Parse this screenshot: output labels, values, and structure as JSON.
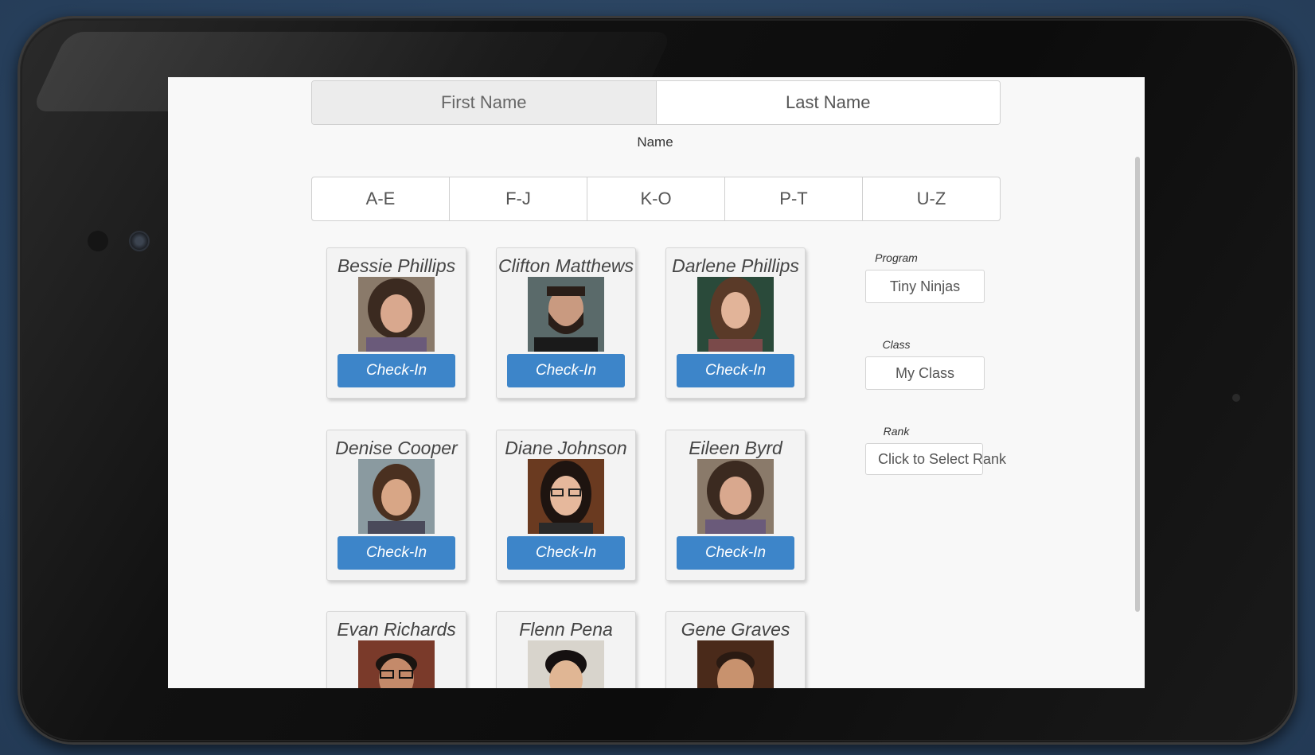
{
  "name_toggle": {
    "first": "First Name",
    "last": "Last Name"
  },
  "sort_label": "Name",
  "alpha_ranges": [
    "A-E",
    "F-J",
    "K-O",
    "P-T",
    "U-Z"
  ],
  "students": [
    {
      "name": "Bessie Phillips",
      "photo": "woman-curly-hair-photo",
      "action": "Check-In"
    },
    {
      "name": "Clifton Matthews",
      "photo": "man-beard-photo",
      "action": "Check-In"
    },
    {
      "name": "Darlene Phillips",
      "photo": "woman-long-hair-photo",
      "action": "Check-In"
    },
    {
      "name": "Denise Cooper",
      "photo": "woman-brown-hair-photo",
      "action": "Check-In"
    },
    {
      "name": "Diane Johnson",
      "photo": "woman-glasses-photo",
      "action": "Check-In"
    },
    {
      "name": "Eileen Byrd",
      "photo": "woman-curly-hair-photo",
      "action": "Check-In"
    },
    {
      "name": "Evan Richards",
      "photo": "man-glasses-photo",
      "action": ""
    },
    {
      "name": "Flenn Pena",
      "photo": "man-short-hair-photo",
      "action": ""
    },
    {
      "name": "Gene Graves",
      "photo": "man-smiling-photo",
      "action": ""
    }
  ],
  "filters": {
    "program_label": "Program",
    "program_value": "Tiny Ninjas",
    "class_label": "Class",
    "class_value": "My Class",
    "rank_label": "Rank",
    "rank_value": "Click to Select Rank"
  },
  "colors": {
    "checkin_button": "#3d85c9",
    "background": "#2a4360"
  }
}
